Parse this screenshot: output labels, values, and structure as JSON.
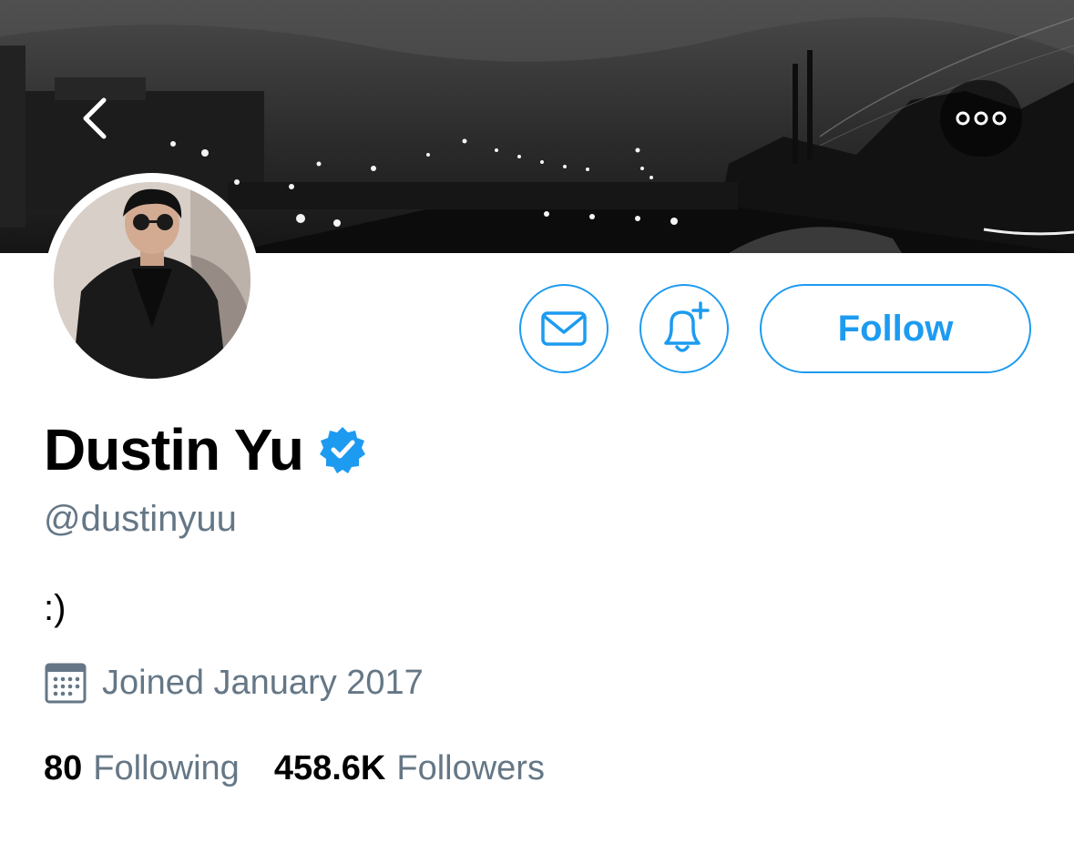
{
  "profile": {
    "display_name": "Dustin Yu",
    "handle": "@dustinyuu",
    "bio": ":)",
    "joined": "Joined January 2017",
    "verified": true
  },
  "actions": {
    "follow_label": "Follow"
  },
  "stats": {
    "following_count": "80",
    "following_label": "Following",
    "followers_count": "458.6K",
    "followers_label": "Followers"
  },
  "icons": {
    "back": "chevron-left-icon",
    "more": "more-horizontal-icon",
    "message": "envelope-icon",
    "notify": "bell-plus-icon",
    "verified": "verified-badge-icon",
    "calendar": "calendar-icon"
  },
  "colors": {
    "accent": "#1d9bf0",
    "secondary_text": "#657786",
    "primary_text": "#000000"
  }
}
